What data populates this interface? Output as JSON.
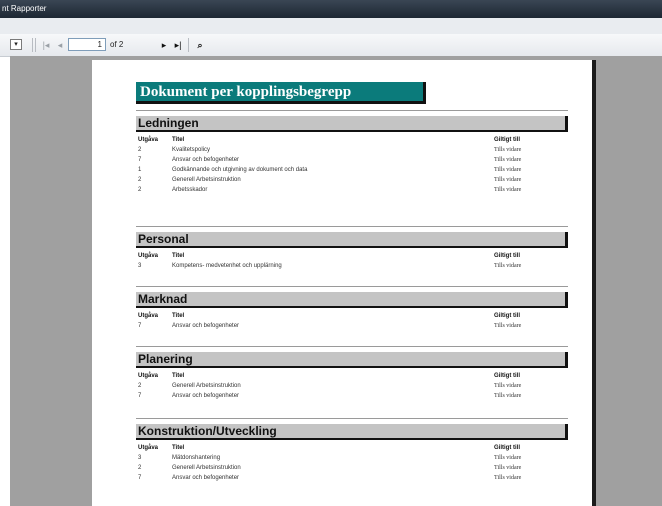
{
  "window": {
    "title": "nt Rapporter"
  },
  "toolbar": {
    "dropdown_glyph": "▾",
    "first_icon": "|◂",
    "prev_icon": "◂",
    "page_current": "1",
    "page_of": "of 2",
    "next_icon": "▸",
    "last_icon": "▸|",
    "find_icon": "⌕"
  },
  "report": {
    "title": "Dokument per kopplingsbegrepp",
    "headers": {
      "utgava": "Utgåva",
      "titel": "Titel",
      "giltig": "Giltigt till"
    },
    "sections": [
      {
        "name": "Ledningen",
        "rows": [
          {
            "utgava": "2",
            "titel": "Kvalitetspolicy",
            "giltig": "Tills vidare"
          },
          {
            "utgava": "7",
            "titel": "Ansvar och befogenheter",
            "giltig": "Tills vidare"
          },
          {
            "utgava": "1",
            "titel": "Godkännande och utgivning av dokument och data",
            "giltig": "Tills vidare"
          },
          {
            "utgava": "2",
            "titel": "Generell Arbetsinstruktion",
            "giltig": "Tills vidare"
          },
          {
            "utgava": "2",
            "titel": "Arbetsskador",
            "giltig": "Tills vidare"
          }
        ]
      },
      {
        "name": "Personal",
        "rows": [
          {
            "utgava": "3",
            "titel": "Kompetens- medvetenhet och upplärning",
            "giltig": "Tills vidare"
          }
        ]
      },
      {
        "name": "Marknad",
        "rows": [
          {
            "utgava": "7",
            "titel": "Ansvar och befogenheter",
            "giltig": "Tills vidare"
          }
        ]
      },
      {
        "name": "Planering",
        "rows": [
          {
            "utgava": "2",
            "titel": "Generell Arbetsinstruktion",
            "giltig": "Tills vidare"
          },
          {
            "utgava": "7",
            "titel": "Ansvar och befogenheter",
            "giltig": "Tills vidare"
          }
        ]
      },
      {
        "name": "Konstruktion/Utveckling",
        "rows": [
          {
            "utgava": "3",
            "titel": "Mätdonshantering",
            "giltig": "Tills vidare"
          },
          {
            "utgava": "2",
            "titel": "Generell Arbetsinstruktion",
            "giltig": "Tills vidare"
          },
          {
            "utgava": "7",
            "titel": "Ansvar och befogenheter",
            "giltig": "Tills vidare"
          }
        ]
      }
    ]
  }
}
